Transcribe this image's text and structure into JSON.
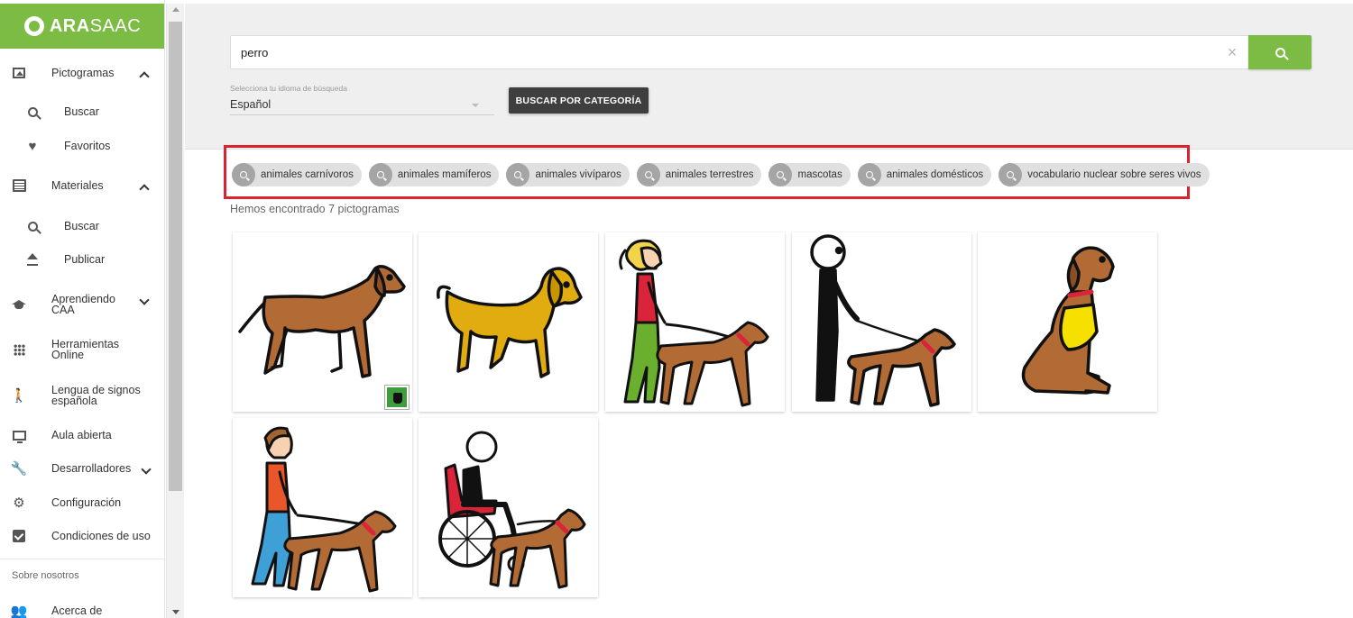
{
  "brand": {
    "prefix": "ARA",
    "suffix": "SAAC"
  },
  "sidebar": {
    "pictogramas": {
      "label": "Pictogramas",
      "buscar": "Buscar",
      "favoritos": "Favoritos"
    },
    "materiales": {
      "label": "Materiales",
      "buscar": "Buscar",
      "publicar": "Publicar"
    },
    "aprendiendo": {
      "line1": "Aprendiendo",
      "line2": "CAA"
    },
    "herramientas": {
      "line1": "Herramientas",
      "line2": "Online"
    },
    "lengua": {
      "line1": "Lengua de signos",
      "line2": "española"
    },
    "aula": "Aula abierta",
    "desarrolladores": "Desarrolladores",
    "configuracion": "Configuración",
    "condiciones": "Condiciones de uso",
    "sobre_nosotros": "Sobre nosotros",
    "acerca": "Acerca de"
  },
  "search": {
    "value": "perro",
    "clear_icon": "close-icon",
    "button_icon": "search-icon"
  },
  "language": {
    "label": "Selecciona tu idioma de búsqueda",
    "selected": "Español"
  },
  "category_button": "BUSCAR POR CATEGORÍA",
  "chips": [
    "animales carnívoros",
    "animales mamíferos",
    "animales vivíparos",
    "animales terrestres",
    "mascotas",
    "animales domésticos",
    "vocabulario nuclear sobre seres vivos"
  ],
  "results_count": "Hemos encontrado 7 pictogramas",
  "colors": {
    "brand_green": "#7cbb44",
    "highlight_red": "#d9232e",
    "dark_button": "#3f3f3f",
    "dog_brown": "#b06a32",
    "dog_yellow": "#e0ac10"
  }
}
